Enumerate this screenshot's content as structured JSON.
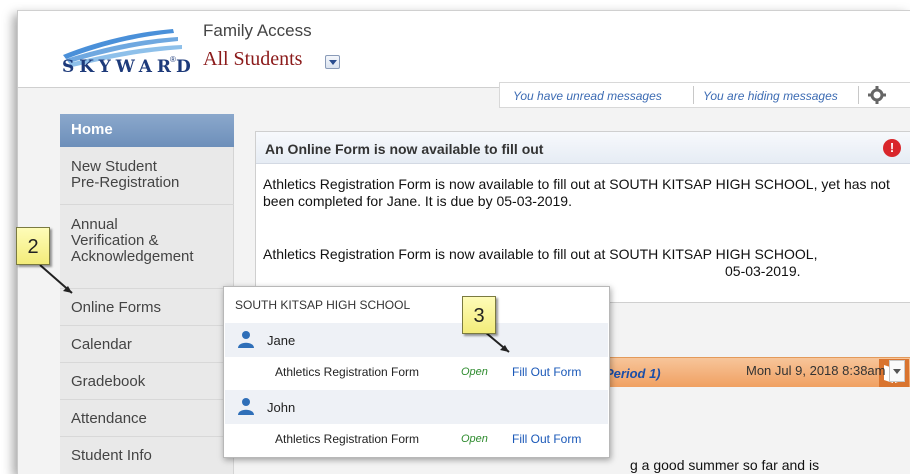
{
  "header": {
    "logo_text": "SKYWARD",
    "logo_mark": "®",
    "app_title": "Family Access",
    "student_select": "All Students"
  },
  "messages": {
    "unread": "You have unread messages",
    "hiding": "You are hiding messages"
  },
  "sidebar": {
    "items": [
      {
        "label": "Home",
        "active": true
      },
      {
        "label": "New Student\nPre-Registration"
      },
      {
        "label": "Annual\nVerification &\nAcknowledgement"
      },
      {
        "label": "Online Forms"
      },
      {
        "label": "Calendar"
      },
      {
        "label": "Gradebook"
      },
      {
        "label": "Attendance"
      },
      {
        "label": "Student Info"
      }
    ]
  },
  "notice": {
    "title": "An Online Form is now available to fill out",
    "para1": "Athletics Registration Form is now available to fill out at SOUTH KITSAP HIGH SCHOOL, yet has not been completed for Jane. It is due by 05-03-2019.",
    "para2_line1": "Athletics Registration Form is now available to fill out at SOUTH KITSAP HIGH SCHOOL,",
    "para2_line2_visible": "05-03-2019."
  },
  "secondary": {
    "period": "Period 1)",
    "timestamp": "Mon Jul 9, 2018 8:38am",
    "partial_text": "g a good summer so far and is"
  },
  "popup": {
    "school": "SOUTH KITSAP HIGH SCHOOL",
    "students": [
      {
        "name": "Jane",
        "form": "Athletics Registration Form",
        "status": "Open",
        "action": "Fill Out Form"
      },
      {
        "name": "John",
        "form": "Athletics Registration Form",
        "status": "Open",
        "action": "Fill Out Form"
      }
    ]
  },
  "callouts": [
    "2",
    "3"
  ],
  "colors": {
    "nav_active": "#7b9bc4",
    "brand_red": "#8b1a1a",
    "link_blue": "#1a58b8",
    "status_green": "#2e8b2e",
    "callout_yellow": "#f8f39a"
  }
}
